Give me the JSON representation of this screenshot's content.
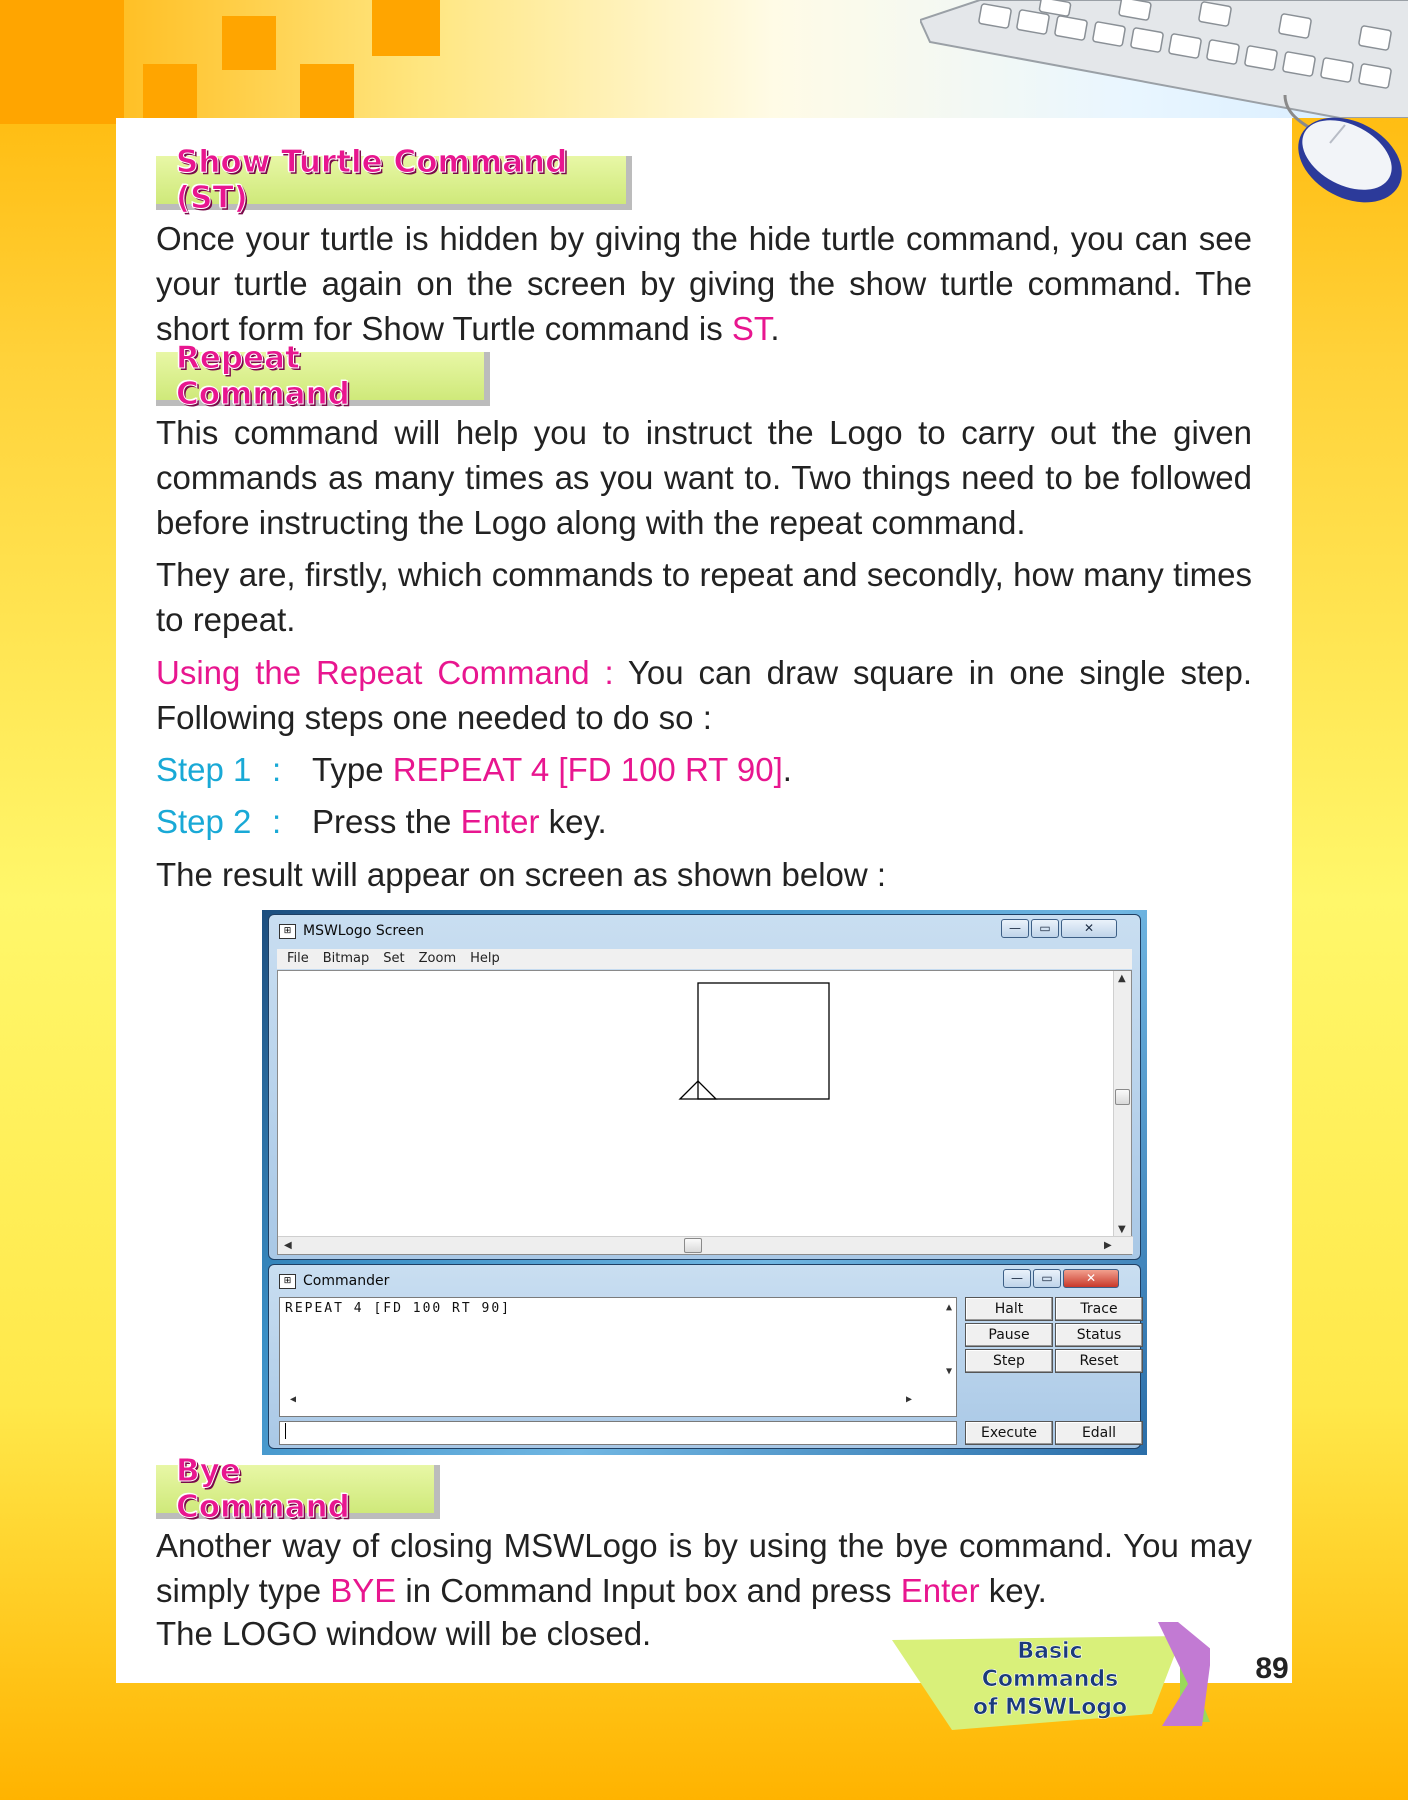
{
  "sections": {
    "show_turtle": {
      "heading": "Show Turtle Command (ST)",
      "text_part1": "Once your turtle is hidden by giving the hide turtle command, you can see your turtle again on the screen by giving the show turtle command. The short form for Show Turtle command is ",
      "text_highlight": "ST",
      "text_part2": "."
    },
    "repeat": {
      "heading": "Repeat Command",
      "paragraph1": "This command will help you to instruct the Logo to carry out the given commands as many times as you want to. Two things need to be followed before instructing the Logo along with the repeat command.",
      "paragraph2": "They are, firstly, which commands to repeat and secondly, how many times to repeat.",
      "using_label": "Using the Repeat Command :",
      "using_text": " You can draw square in one single step. Following steps one needed to do so :",
      "step1_label": "Step 1",
      "step1_colon": ":",
      "step1_pre": "Type ",
      "step1_highlight": "REPEAT 4 [FD 100 RT 90]",
      "step1_post": ".",
      "step2_label": "Step 2",
      "step2_colon": ":",
      "step2_pre": "Press the ",
      "step2_highlight": "Enter",
      "step2_post": " key.",
      "result_text": "The result will appear on screen as shown below :"
    },
    "bye": {
      "heading": "Bye Command",
      "text_part1": "Another way of closing MSWLogo is by using the bye command. You may simply type ",
      "highlight1": "BYE",
      "text_part2": " in Command Input box and press ",
      "highlight2": "Enter",
      "text_part3": " key.",
      "line3": "The LOGO window will be closed."
    }
  },
  "screenshot": {
    "screen_window": {
      "title": "MSWLogo Screen",
      "menu": [
        "File",
        "Bitmap",
        "Set",
        "Zoom",
        "Help"
      ]
    },
    "commander_window": {
      "title": "Commander",
      "history_text": "REPEAT 4 [FD 100 RT 90]",
      "input_value": "",
      "buttons": {
        "halt": "Halt",
        "trace": "Trace",
        "pause": "Pause",
        "status": "Status",
        "step": "Step",
        "reset": "Reset",
        "execute": "Execute",
        "edall": "Edall"
      }
    }
  },
  "footer": {
    "chapter_line1": "Basic Commands",
    "chapter_line2": "of MSWLogo",
    "page_number": "89"
  },
  "colors": {
    "highlight": "#e8168f",
    "step_label": "#19a9d6",
    "heading_tab": "#d6ee88"
  }
}
